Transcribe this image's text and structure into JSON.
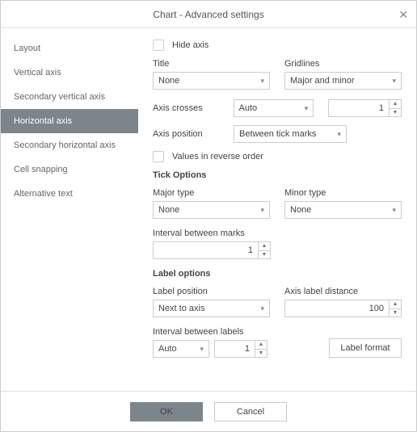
{
  "dialog": {
    "title": "Chart - Advanced settings"
  },
  "sidebar": {
    "items": [
      {
        "label": "Layout"
      },
      {
        "label": "Vertical axis"
      },
      {
        "label": "Secondary vertical axis"
      },
      {
        "label": "Horizontal axis",
        "active": true
      },
      {
        "label": "Secondary horizontal axis"
      },
      {
        "label": "Cell snapping"
      },
      {
        "label": "Alternative text"
      }
    ]
  },
  "content": {
    "hide_axis_label": "Hide axis",
    "title": {
      "label": "Title",
      "value": "None"
    },
    "gridlines": {
      "label": "Gridlines",
      "value": "Major and minor"
    },
    "axis_crosses": {
      "label": "Axis crosses",
      "value": "Auto",
      "num": "1"
    },
    "axis_position": {
      "label": "Axis position",
      "value": "Between tick marks"
    },
    "reverse_label": "Values in reverse order",
    "tick_section": "Tick Options",
    "major_type": {
      "label": "Major type",
      "value": "None"
    },
    "minor_type": {
      "label": "Minor type",
      "value": "None"
    },
    "interval_marks": {
      "label": "Interval between marks",
      "value": "1"
    },
    "label_section": "Label options",
    "label_position": {
      "label": "Label position",
      "value": "Next to axis"
    },
    "axis_label_distance": {
      "label": "Axis label distance",
      "value": "100"
    },
    "interval_labels": {
      "label": "Interval between labels",
      "value": "Auto",
      "num": "1"
    },
    "label_format_btn": "Label format"
  },
  "footer": {
    "ok": "OK",
    "cancel": "Cancel"
  }
}
